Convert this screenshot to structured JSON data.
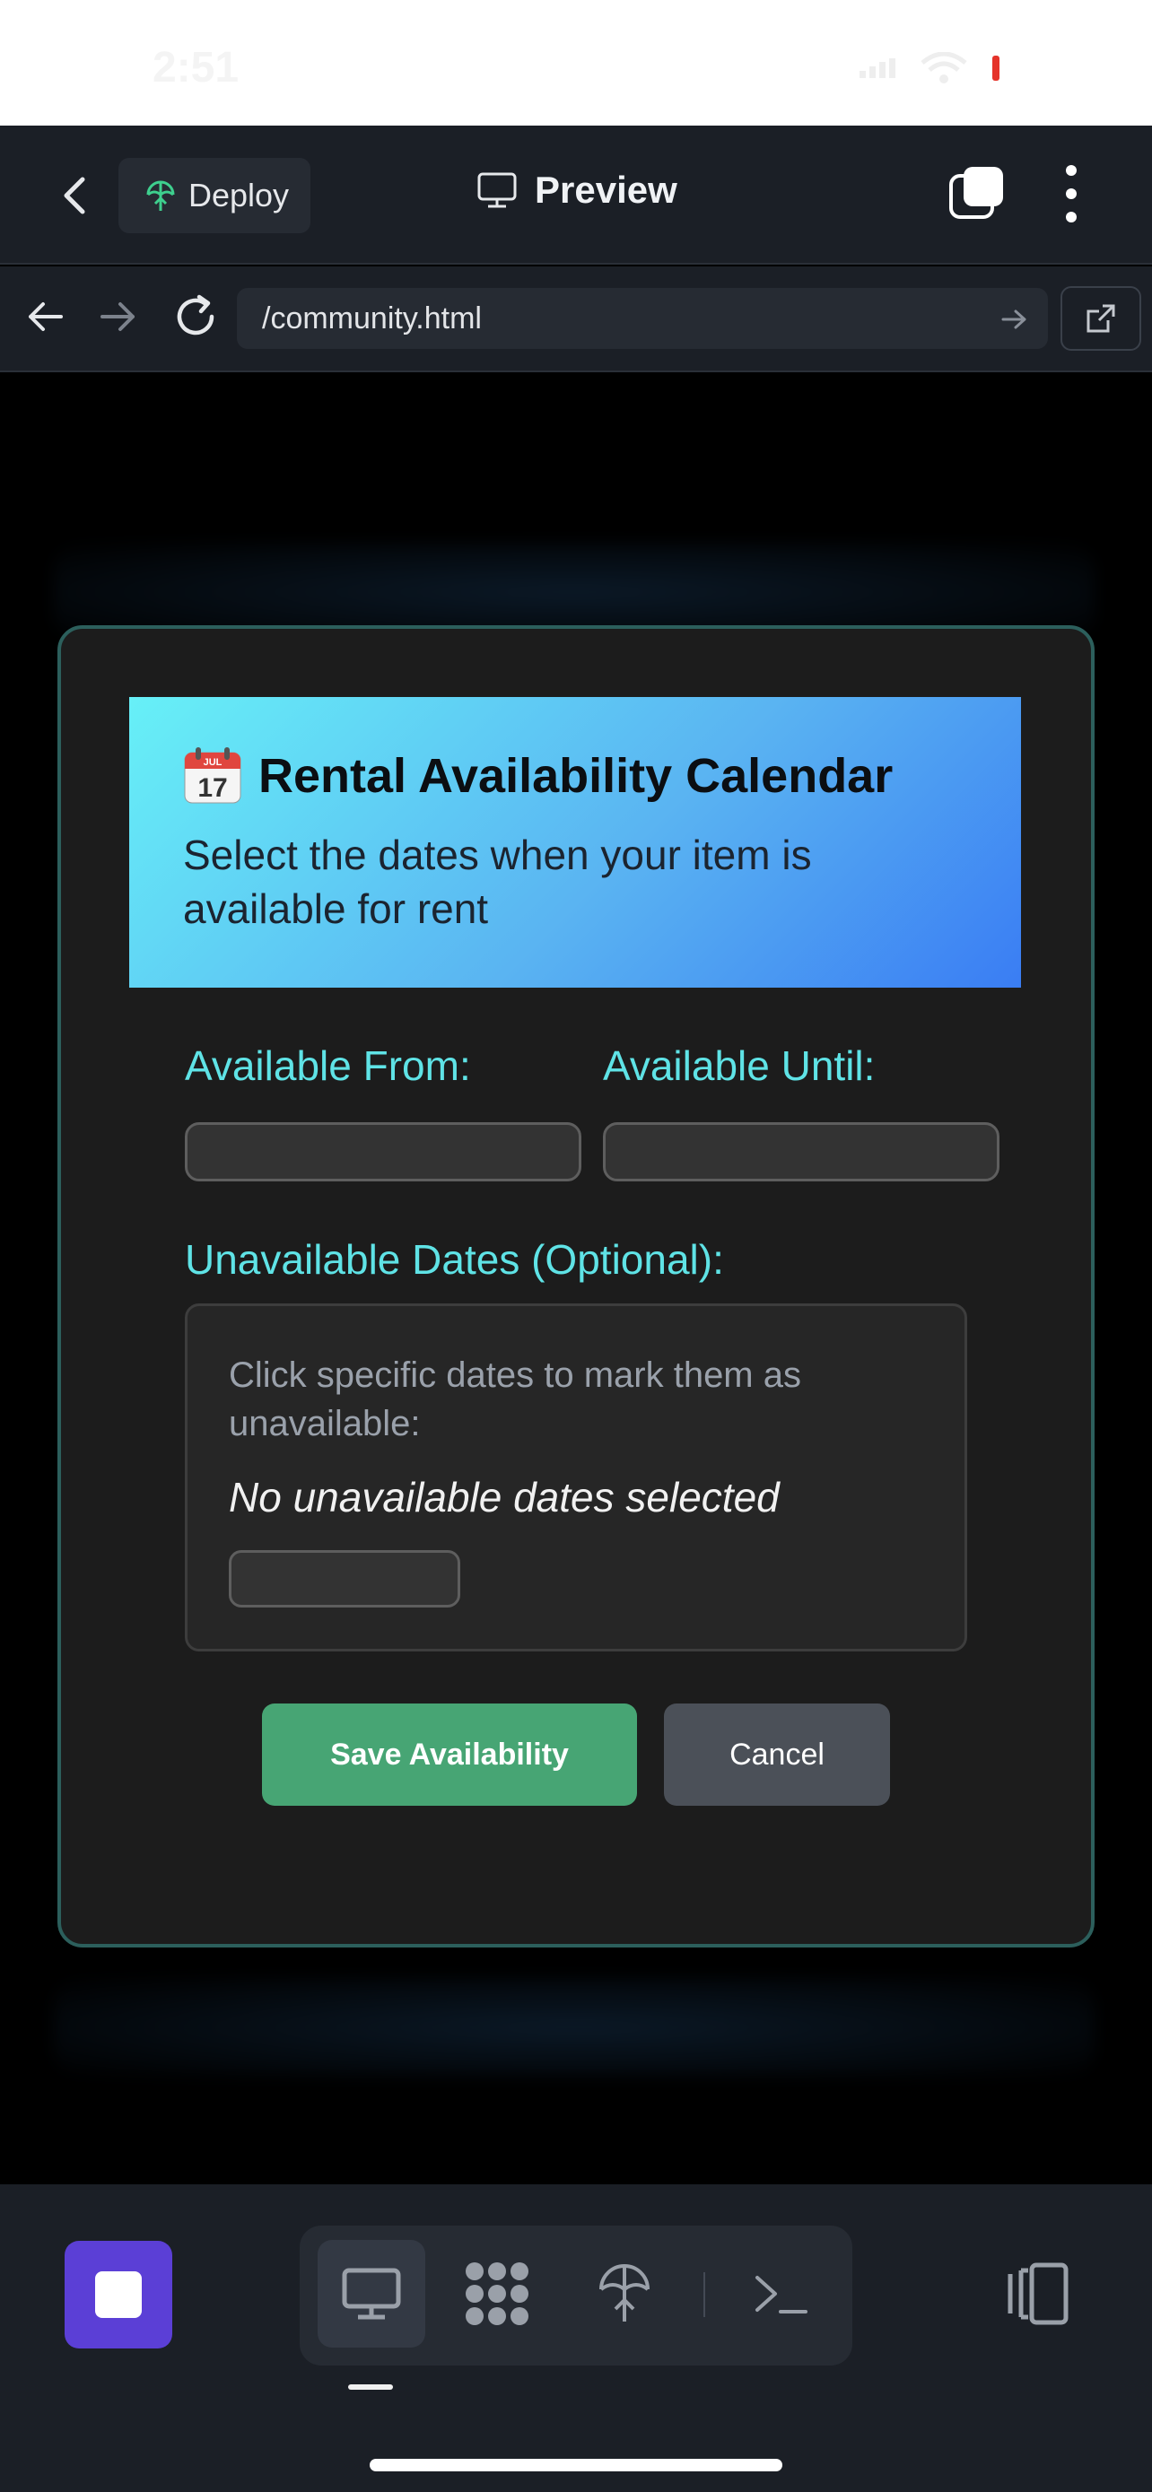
{
  "status_bar": {
    "time": "2:51"
  },
  "header": {
    "deploy_label": "Deploy",
    "preview_label": "Preview"
  },
  "browser": {
    "url": "/community.html"
  },
  "modal": {
    "title": "Rental Availability Calendar",
    "subtitle": "Select the dates when your item is available for rent",
    "from_label": "Available From:",
    "until_label": "Available Until:",
    "from_value": "",
    "until_value": "",
    "unavailable_label": "Unavailable Dates (Optional):",
    "unavailable_hint": "Click specific dates to mark them as unavailable:",
    "unavailable_empty": "No unavailable dates selected",
    "save_label": "Save Availability",
    "cancel_label": "Cancel",
    "calendar_icon_text": {
      "month": "JUL",
      "day": "17"
    }
  },
  "colors": {
    "accent": "#5fe3e6",
    "save_button": "#47a574",
    "cancel_button": "#4b5058",
    "stop_button": "#5b3fd6",
    "header_gradient_start": "#67f0f7",
    "header_gradient_end": "#3a7df3"
  },
  "toolbar": {
    "tools": [
      "desktop-preview-icon",
      "grid-icon",
      "deploy-icon",
      "terminal-icon"
    ],
    "active_tool": "desktop-preview-icon"
  }
}
